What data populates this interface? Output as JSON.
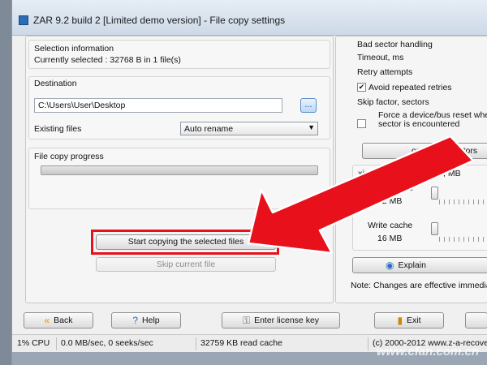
{
  "window": {
    "title": "ZAR 9.2 build 2 [Limited demo version] - File copy settings"
  },
  "left": {
    "selection": {
      "heading": "Selection information",
      "text": "Currently selected : 32768 B in 1 file(s)"
    },
    "destination": {
      "heading": "Destination",
      "path": "C:\\Users\\User\\Desktop",
      "browse_label": "...",
      "existing_label": "Existing files",
      "existing_value": "Auto rename"
    },
    "progress": {
      "heading": "File copy progress",
      "percent": 0
    },
    "start_label": "Start copying the selected files",
    "skip_label": "Skip current file"
  },
  "right": {
    "bad_sector_heading": "Bad sector handling",
    "timeout_label": "Timeout, ms",
    "retry_label": "Retry attempts",
    "avoid_label": "Avoid repeated retries",
    "avoid_checked_mark": "✔",
    "skip_factor_label": "Skip factor, sectors",
    "force_line1": "Force a device/bus reset whe",
    "force_line2": "sector is encountered",
    "forget_label": "orget bad sectors",
    "cache_heading": "ximum disk cache size, MB",
    "read_cache_label": "Read cache",
    "read_cache_value": "32 MB",
    "write_cache_label": "Write cache",
    "write_cache_value": "16 MB",
    "explain_label": "Explain",
    "note": "Note: Changes are effective immedia"
  },
  "footer": {
    "back_label": "Back",
    "help_label": "Help",
    "license_label": "Enter license key",
    "exit_label": "Exit"
  },
  "status": {
    "cpu": "1% CPU",
    "speed": "0.0 MB/sec, 0 seeks/sec",
    "cache": "32759 KB read cache",
    "copyright": "(c) 2000-2012 www.z-a-recove"
  },
  "watermark": "www.cfan.com.cn"
}
